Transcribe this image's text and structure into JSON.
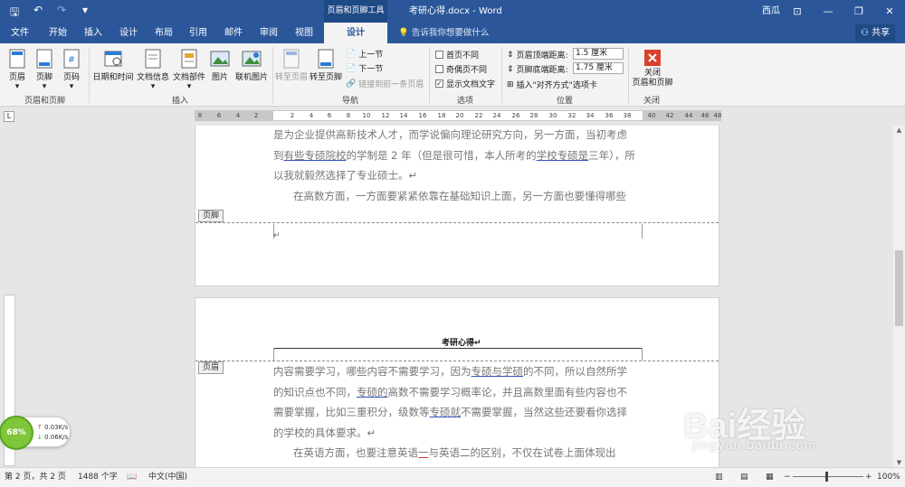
{
  "titlebar": {
    "context_tools": "页眉和页脚工具",
    "doc_title": "考研心得.docx - Word",
    "user": "西瓜",
    "qat_save": "🖫",
    "qat_undo": "↶",
    "qat_redo": "↷",
    "qat_more": "▾",
    "win_ribbon_opts": "⊡",
    "win_minimize": "—",
    "win_restore": "❐",
    "win_close": "✕"
  },
  "tabs": {
    "items": [
      "文件",
      "开始",
      "插入",
      "设计",
      "布局",
      "引用",
      "邮件",
      "审阅",
      "视图"
    ],
    "active": "设计",
    "tell_me": "告诉我你想要做什么",
    "share": "共享"
  },
  "ribbon": {
    "header_footer": {
      "header": "页眉",
      "footer": "页脚",
      "page_number": "页码",
      "label": "页眉和页脚"
    },
    "insert": {
      "datetime": "日期和时间",
      "docinfo": "文档信息",
      "docparts": "文档部件",
      "picture": "图片",
      "online_picture": "联机图片",
      "label": "插入"
    },
    "navigation": {
      "goto_header": "转至页眉",
      "goto_footer": "转至页脚",
      "prev": "上一节",
      "next": "下一节",
      "link_prev": "链接到前一条页眉",
      "label": "导航"
    },
    "options": {
      "diff_first": "首页不同",
      "diff_oddeven": "奇偶页不同",
      "show_text": "显示文档文字",
      "label": "选项"
    },
    "position": {
      "header_top": "页眉顶端距离:",
      "header_top_val": "1.5 厘米",
      "footer_bottom": "页脚底端距离:",
      "footer_bottom_val": "1.75 厘米",
      "insert_align_tab": "插入\"对齐方式\"选项卡",
      "label": "位置"
    },
    "close": {
      "button": "关闭\n页眉和页脚",
      "label": "关闭"
    }
  },
  "ruler": {
    "left_nums": [
      "8",
      "6",
      "4",
      "2"
    ],
    "nums": [
      "2",
      "4",
      "6",
      "8",
      "10",
      "12",
      "14",
      "16",
      "18",
      "20",
      "22",
      "24",
      "26",
      "28",
      "30",
      "32",
      "34",
      "36",
      "38"
    ],
    "right_nums": [
      "40",
      "42",
      "44",
      "46",
      "48"
    ],
    "tab_selector": "L"
  },
  "page1": {
    "line1": "是为企业提供高新技术人才，而学说偏向理论研究方向，另一方面，当初考虑",
    "line2_a": "到",
    "line2_b": "有些专硕院校",
    "line2_c": "的学制是 2 年（但是很可惜，本人所考的",
    "line2_d": "学校专硕是",
    "line2_e": "三年），所",
    "line3": "以我就毅然选择了专业硕士。↵",
    "line4": "在高数方面，一方面要紧紧依靠在基础知识上面，另一方面也要懂得哪些",
    "footer_tag": "页脚",
    "footer_mark": "↵"
  },
  "page2": {
    "header_title": "考研心得↵",
    "header_tag": "页眉",
    "line1_a": "内容需要学习，哪些内容不需要学习，因为",
    "line1_b": "专硕与学硕",
    "line1_c": "的不同，所以自然所学",
    "line2_a": "的知识点也不同，",
    "line2_b": "专硕的",
    "line2_c": "高数不需要学习概率论，并且高数里面有些内容也不",
    "line3_a": "需要掌握，比如三重积分，级数等",
    "line3_b": "专硕就",
    "line3_c": "不需要掌握，当然这些还要看你选择",
    "line4": "的学校的具体要求。↵",
    "line5_a": "在英语方面，也要注意英语",
    "line5_b": "一",
    "line5_c": "与英语二的区别，不仅在试卷上面体现出"
  },
  "statusbar": {
    "page": "第 2 页，共 2 页",
    "words": "1488 个字",
    "lang": "中文(中国)",
    "zoom": "100%",
    "zoom_minus": "−",
    "zoom_plus": "+"
  },
  "netwidget": {
    "percent": "68%",
    "up": "0.03K/s",
    "down": "0.06K/s"
  },
  "watermark": {
    "brand": "Bai经验",
    "url": "jingyan.baidu.com"
  },
  "colors": {
    "brand": "#2b579a",
    "close_red": "#d9412c"
  }
}
